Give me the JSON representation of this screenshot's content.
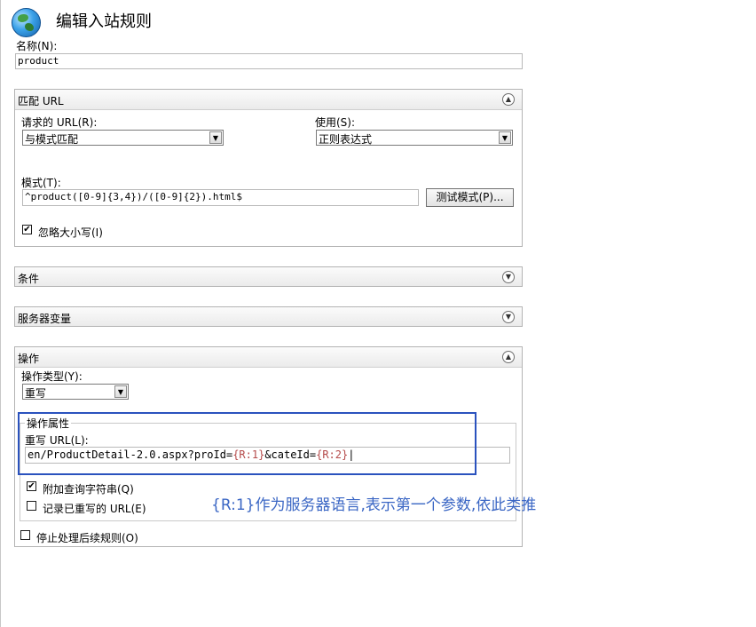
{
  "header": {
    "title": "编辑入站规则",
    "icon": "globe-icon"
  },
  "name_field": {
    "label": "名称(N):",
    "value": "product"
  },
  "match_url": {
    "title": "匹配 URL",
    "requested_url": {
      "label": "请求的 URL(R):",
      "selected": "与模式匹配"
    },
    "using": {
      "label": "使用(S):",
      "selected": "正则表达式"
    },
    "pattern": {
      "label": "模式(T):",
      "value": "^product([0-9]{3,4})/([0-9]{2}).html$"
    },
    "test_button": "测试模式(P)...",
    "ignore_case": {
      "label": "忽略大小写(I)",
      "checked": true
    }
  },
  "conditions": {
    "title": "条件"
  },
  "server_variables": {
    "title": "服务器变量"
  },
  "action": {
    "title": "操作",
    "type": {
      "label": "操作类型(Y):",
      "selected": "重写"
    },
    "properties": {
      "title": "操作属性",
      "rewrite_url_label": "重写 URL(L):",
      "rewrite_url": {
        "p1": "en/ProductDetail-2.0.aspx?proId=",
        "r1": "{R:1}",
        "p2": "&cateId=",
        "r2": "{R:2}"
      },
      "append_query": {
        "label": "附加查询字符串(Q)",
        "checked": true
      },
      "log_rewritten": {
        "label": "记录已重写的 URL(E)",
        "checked": false
      }
    },
    "stop_processing": {
      "label": "停止处理后续规则(O)",
      "checked": false
    }
  },
  "annotation": "{R:1}作为服务器语言,表示第一个参数,依此类推",
  "colors": {
    "highlight_border": "#2a52be",
    "annotation_text": "#3a66c4",
    "param_text": "#b54a4a"
  },
  "icons": {
    "collapse": "chevron-up-icon",
    "expand": "chevron-down-icon",
    "dropdown": "dropdown-arrow-icon",
    "check": "checkmark-icon"
  }
}
